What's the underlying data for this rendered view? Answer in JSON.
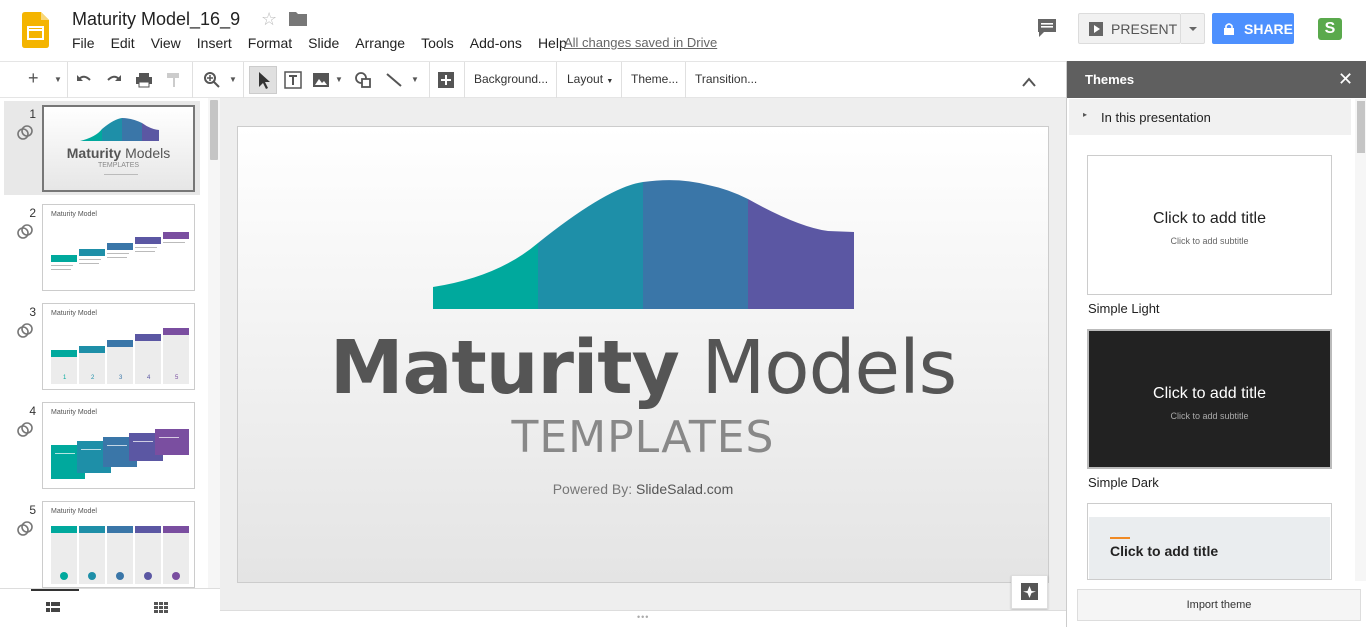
{
  "app": {
    "doc_title": "Maturity Model_16_9",
    "save_status": "All changes saved in Drive"
  },
  "menu": [
    "File",
    "Edit",
    "View",
    "Insert",
    "Format",
    "Slide",
    "Arrange",
    "Tools",
    "Add-ons",
    "Help"
  ],
  "header": {
    "present_label": "PRESENT",
    "share_label": "SHARE",
    "account_initial": "S"
  },
  "toolbar": {
    "background": "Background...",
    "layout": "Layout",
    "theme": "Theme...",
    "transition": "Transition..."
  },
  "filmstrip": {
    "slides": [
      {
        "num": "1",
        "title": ""
      },
      {
        "num": "2",
        "title": "Maturity Model"
      },
      {
        "num": "3",
        "title": "Maturity Model"
      },
      {
        "num": "4",
        "title": "Maturity Model"
      },
      {
        "num": "5",
        "title": "Maturity Model"
      }
    ],
    "thumb1": {
      "title_bold": "Maturity",
      "title_rest": " Models",
      "subtitle": "TEMPLATES"
    },
    "slide3_numbers": [
      "1",
      "2",
      "3",
      "4",
      "5"
    ]
  },
  "slide": {
    "title_bold": "Maturity",
    "title_rest": " Models",
    "subtitle": "TEMPLATES",
    "credit_prefix": "Powered By: ",
    "credit_brand": "SlideSalad.com",
    "curve_colors": [
      "#00a99d",
      "#1e8fa8",
      "#3a76a8",
      "#5b57a3"
    ]
  },
  "themes_panel": {
    "title": "Themes",
    "section": "In this presentation",
    "themes": [
      {
        "name": "Simple Light",
        "title": "Click to add title",
        "subtitle": "Click to add subtitle"
      },
      {
        "name": "Simple Dark",
        "title": "Click to add title",
        "subtitle": "Click to add subtitle"
      },
      {
        "name": "",
        "title": "Click to add title",
        "subtitle": ""
      }
    ],
    "import_label": "Import theme"
  },
  "colors": {
    "accent_blue": "#4d90fe",
    "panel_header": "#5f5f5f",
    "slides_logo": "#f4b400"
  }
}
